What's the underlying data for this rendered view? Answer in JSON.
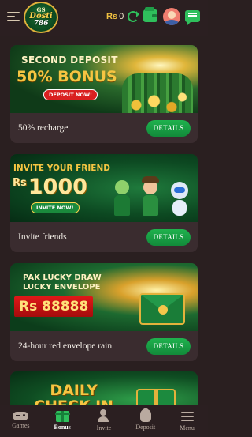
{
  "header": {
    "logo": {
      "line1": "GS",
      "line2": "Dosti",
      "line3": "786"
    },
    "currency": "Rs",
    "balance": "0",
    "icons": [
      "menu-icon",
      "refresh-icon",
      "wallet-icon",
      "avatar",
      "chat-icon"
    ]
  },
  "promotions": [
    {
      "banner_line1": "SECOND DEPOSIT",
      "banner_line2": "50% BONUS",
      "banner_button": "DEPOSIT NOW!",
      "label": "50% recharge",
      "button": "DETAILS"
    },
    {
      "banner_line1": "INVITE YOUR FRIEND",
      "banner_currency": "Rs",
      "banner_amount": "1000",
      "banner_button": "INVITE NOW!",
      "label": "Invite friends",
      "button": "DETAILS"
    },
    {
      "banner_line1": "PAK LUCKY DRAW",
      "banner_line2": "LUCKY ENVELOPE",
      "banner_amount": "Rs 88888",
      "label": "24-hour red envelope rain",
      "button": "DETAILS"
    },
    {
      "banner_line1": "DAILY",
      "banner_line2": "CHECK IN"
    }
  ],
  "nav": {
    "active": "Bonus",
    "items": [
      {
        "label": "Games",
        "icon": "gamepad-icon"
      },
      {
        "label": "Bonus",
        "icon": "gift-icon"
      },
      {
        "label": "Invite",
        "icon": "users-icon"
      },
      {
        "label": "Deposit",
        "icon": "money-bag-icon"
      },
      {
        "label": "Menu",
        "icon": "hamburger-icon"
      }
    ]
  },
  "colors": {
    "background": "#2a1f20",
    "card": "#3a2c2f",
    "accent_green": "#1fb24e",
    "gold": "#f5c542"
  }
}
